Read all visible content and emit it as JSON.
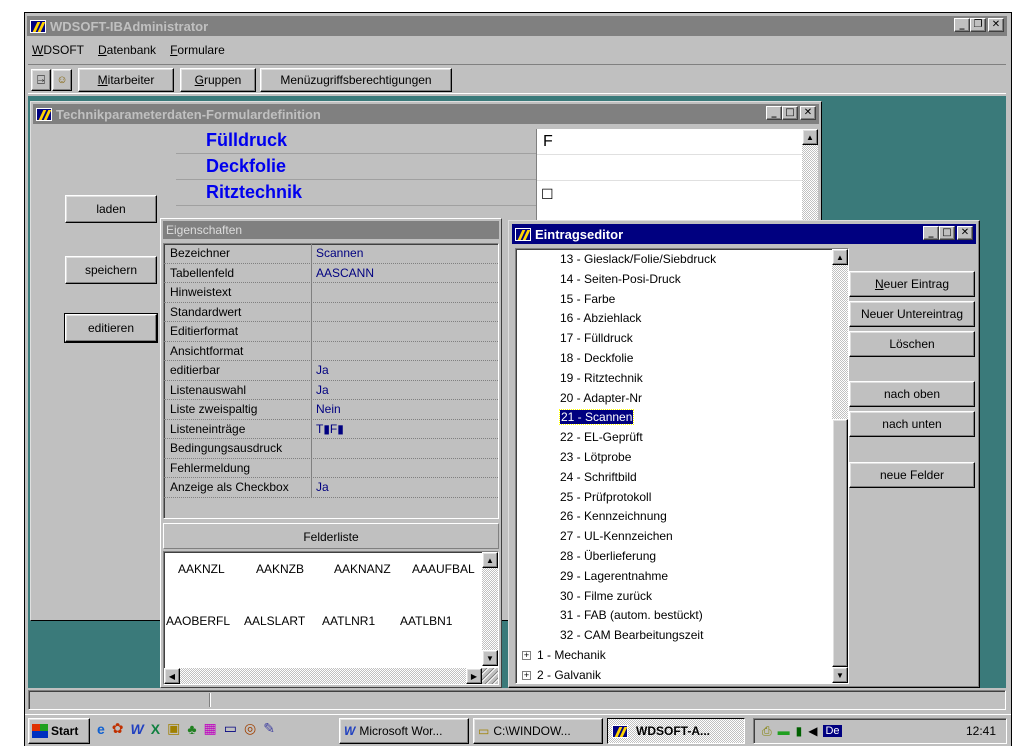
{
  "app": {
    "title": "WDSOFT-IBAdministrator"
  },
  "menu": [
    {
      "label": "WDSOFT",
      "ul": "W",
      "rest": "DSOFT"
    },
    {
      "label": "Datenbank",
      "ul": "D",
      "rest": "atenbank"
    },
    {
      "label": "Formulare",
      "ul": "F",
      "rest": "ormulare"
    }
  ],
  "toolbar": {
    "mitarbeiter": {
      "ul": "M",
      "rest": "itarbeiter"
    },
    "gruppen": {
      "ul": "G",
      "rest": "ruppen"
    },
    "menue": {
      "ul": "",
      "rest": "Menüzugriffsberechtigungen"
    }
  },
  "formwin": {
    "title": "Technikparameterdaten-Formulardefinition",
    "buttons": {
      "laden": "laden",
      "speichern": "speichern",
      "editieren": "editieren"
    },
    "tech_rows": [
      "Fülldruck",
      "Deckfolie",
      "Ritztechnik"
    ],
    "tech_values": [
      "F",
      "",
      "☐"
    ]
  },
  "props": {
    "header": "Eigenschaften",
    "rows": [
      {
        "key": "Bezeichner",
        "value": "Scannen"
      },
      {
        "key": "Tabellenfeld",
        "value": "AASCANN"
      },
      {
        "key": "Hinweistext",
        "value": ""
      },
      {
        "key": "Standardwert",
        "value": ""
      },
      {
        "key": "Editierformat",
        "value": ""
      },
      {
        "key": "Ansichtformat",
        "value": ""
      },
      {
        "key": "editierbar",
        "value": "Ja"
      },
      {
        "key": "Listenauswahl",
        "value": "Ja"
      },
      {
        "key": "Liste zweispaltig",
        "value": "Nein"
      },
      {
        "key": "Listeneinträge",
        "value": "T▮F▮"
      },
      {
        "key": "Bedingungsausdruck",
        "value": ""
      },
      {
        "key": "Fehlermeldung",
        "value": ""
      },
      {
        "key": "Anzeige als Checkbox",
        "value": "Ja"
      }
    ],
    "felderliste_label": "Felderliste",
    "fields_row1": [
      "AAKNZL",
      "AAKNZB",
      "AAKNANZ",
      "AAAUFBAL"
    ],
    "fields_row2": [
      "AAOBERFL",
      "AALSLART",
      "AATLNR1",
      "AATLBN1"
    ]
  },
  "editor": {
    "title": "Eintragseditor",
    "items": [
      "13 - Gieslack/Folie/Siebdruck",
      "14 - Seiten-Posi-Druck",
      "15 - Farbe",
      "16 - Abziehlack",
      "17 - Fülldruck",
      "18 - Deckfolie",
      "19 - Ritztechnik",
      "20 - Adapter-Nr",
      "21 - Scannen",
      "22 - EL-Geprüft",
      "23 - Lötprobe",
      "24 - Schriftbild",
      "25 - Prüfprotokoll",
      "26 - Kennzeichnung",
      "27 - UL-Kennzeichen",
      "28 - Überlieferung",
      "29 - Lagerentnahme",
      "30 - Filme zurück",
      "31 - FAB (autom. bestückt)",
      "32 - CAM Bearbeitungszeit"
    ],
    "selected_index": 8,
    "roots": [
      "1 - Mechanik",
      "2 - Galvanik"
    ],
    "buttons": {
      "neuer_eintrag": {
        "ul": "N",
        "rest": "euer Eintrag"
      },
      "neuer_untereintrag": "Neuer Untereintrag",
      "loeschen": "Löschen",
      "nach_oben": "nach oben",
      "nach_unten": "nach unten",
      "neue_felder": "neue Felder"
    }
  },
  "taskbar": {
    "start": "Start",
    "tasks": [
      "Microsoft Wor...",
      "C:\\WINDOW...",
      "WDSOFT-A..."
    ],
    "active_task_index": 2,
    "lang": "De",
    "clock": "12:41"
  },
  "colors": {
    "title_active": "#000080",
    "title_inactive": "#808080",
    "mdi_background": "#3a7a7a",
    "face": "#c0c0c0",
    "tech_text": "#0000ee"
  }
}
